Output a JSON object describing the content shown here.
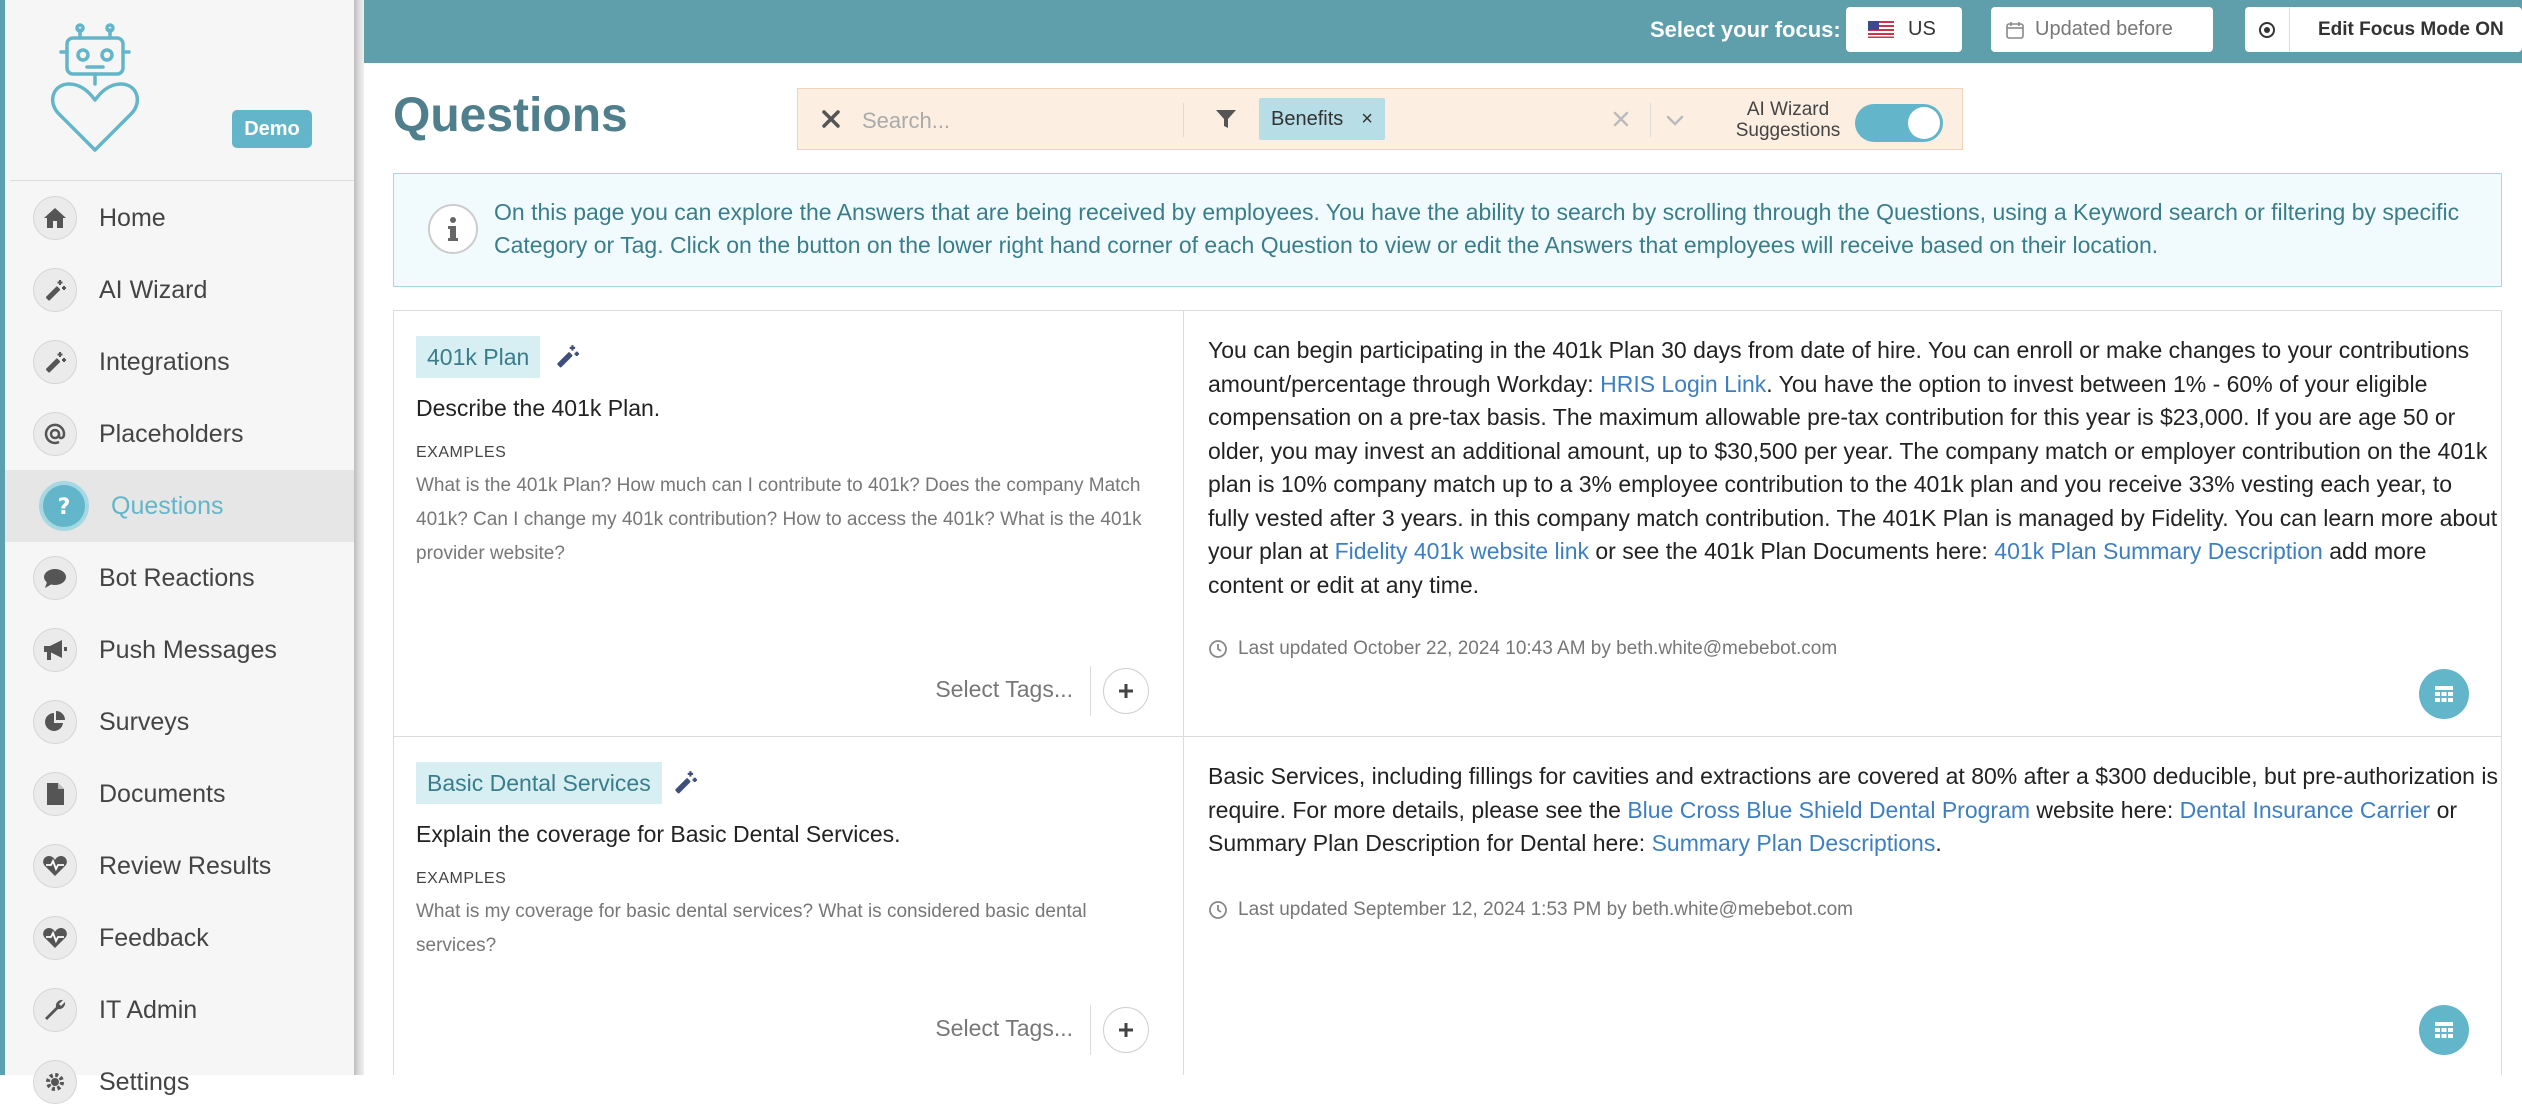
{
  "sidebar": {
    "demo_badge": "Demo",
    "items": [
      {
        "label": "Home"
      },
      {
        "label": "AI Wizard"
      },
      {
        "label": "Integrations"
      },
      {
        "label": "Placeholders"
      },
      {
        "label": "Questions"
      },
      {
        "label": "Bot Reactions"
      },
      {
        "label": "Push Messages"
      },
      {
        "label": "Surveys"
      },
      {
        "label": "Documents"
      },
      {
        "label": "Review Results"
      },
      {
        "label": "Feedback"
      },
      {
        "label": "IT Admin"
      },
      {
        "label": "Settings"
      }
    ],
    "active_item": "Questions",
    "accent_color": "#63b6c9"
  },
  "topbar": {
    "focus_label": "Select your focus:",
    "country": "US",
    "updated_placeholder": "Updated before",
    "edit_focus_label": "Edit Focus Mode ON"
  },
  "page": {
    "title": "Questions"
  },
  "search": {
    "placeholder": "Search...",
    "filter_chip": "Benefits",
    "ai_label_line1": "AI Wizard",
    "ai_label_line2": "Suggestions",
    "ai_toggle_on": true
  },
  "info": {
    "text": "On this page you can explore the Answers that are being received by employees. You have the ability to search by scrolling through the Questions, using a Keyword search or filtering by specific Category or Tag. Click on the button on the lower right hand corner of each Question to view or edit the Answers that employees will receive based on their location."
  },
  "questions": [
    {
      "category": "401k Plan",
      "title": "Describe the 401k Plan.",
      "examples_label": "EXAMPLES",
      "examples": "What is the 401k Plan? How much can I contribute to 401k? Does the company Match 401k? Can I change my 401k contribution? How to access the 401k? What is the 401k provider website?",
      "select_tags": "Select Tags...",
      "answer": {
        "p1": "You can begin participating in the 401k Plan 30 days from date of hire. You can enroll or make changes to your contributions amount/percentage through Workday: ",
        "link1": "HRIS Login Link",
        "p2": ". You have the option to invest between 1% - 60% of your eligible compensation on a pre-tax basis. The maximum allowable pre-tax contribution for this year is $23,000. If you are age 50 or older, you may invest an additional amount, up to $30,500 per year. The company match or employer contribution on the 401k plan is 10% company match up to a 3% employee contribution to the 401k plan and you receive 33% vesting each year, to fully vested after 3 years. in this company match contribution. The 401K Plan is managed by Fidelity. You can learn more about your plan at ",
        "link2": "Fidelity 401k website link",
        "p3": " or see the 401k Plan Documents here: ",
        "link3": "401k Plan Summary Description",
        "p4": " add more content or edit at any time."
      },
      "updated": "Last updated October 22, 2024 10:43 AM by beth.white@mebebot.com"
    },
    {
      "category": "Basic Dental Services",
      "title": "Explain the coverage for Basic Dental Services.",
      "examples_label": "EXAMPLES",
      "examples": "What is my coverage for basic dental services? What is considered basic dental services?",
      "select_tags": "Select Tags...",
      "answer": {
        "p1": "Basic Services, including fillings for cavities and extractions are covered at 80% after a $300 deducible, but pre-authorization is require. For more details, please see the ",
        "link1": "Blue Cross Blue Shield Dental Program",
        "p2": " website here: ",
        "link2": "Dental Insurance Carrier",
        "p3": " or Summary Plan Description for Dental here: ",
        "link3": "Summary Plan Descriptions",
        "p4": "."
      },
      "updated": "Last updated September 12, 2024 1:53 PM by beth.white@mebebot.com"
    }
  ]
}
